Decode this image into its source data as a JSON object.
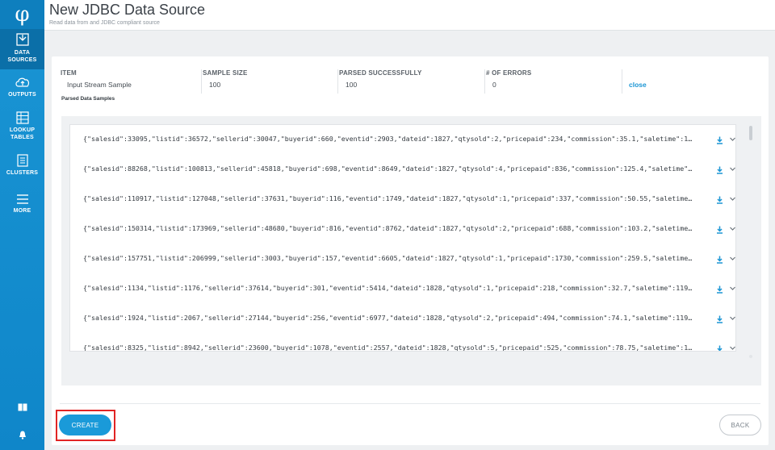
{
  "sidebar": {
    "logo": "φ",
    "items": [
      {
        "label_line1": "DATA",
        "label_line2": "SOURCES"
      },
      {
        "label_line1": "OUTPUTS",
        "label_line2": ""
      },
      {
        "label_line1": "LOOKUP",
        "label_line2": "TABLES"
      },
      {
        "label_line1": "CLUSTERS",
        "label_line2": ""
      },
      {
        "label_line1": "MORE",
        "label_line2": ""
      }
    ]
  },
  "header": {
    "title": "New JDBC Data Source",
    "subtitle": "Read data from and JDBC compliant source"
  },
  "summary": {
    "columns": [
      "ITEM",
      "SAMPLE SIZE",
      "PARSED SUCCESSFULLY",
      "# OF ERRORS"
    ],
    "values": [
      "Input Stream Sample",
      "100",
      "100",
      "0"
    ],
    "close_label": "close"
  },
  "samples": {
    "title": "Parsed Data Samples",
    "rows": [
      "{\"salesid\":33095,\"listid\":36572,\"sellerid\":30047,\"buyerid\":660,\"eventid\":2903,\"dateid\":1827,\"qtysold\":2,\"pricepaid\":234,\"commission\":35.1,\"saletime\":1…",
      "{\"salesid\":88268,\"listid\":100813,\"sellerid\":45818,\"buyerid\":698,\"eventid\":8649,\"dateid\":1827,\"qtysold\":4,\"pricepaid\":836,\"commission\":125.4,\"saletime\"…",
      "{\"salesid\":110917,\"listid\":127048,\"sellerid\":37631,\"buyerid\":116,\"eventid\":1749,\"dateid\":1827,\"qtysold\":1,\"pricepaid\":337,\"commission\":50.55,\"saletime…",
      "{\"salesid\":150314,\"listid\":173969,\"sellerid\":48680,\"buyerid\":816,\"eventid\":8762,\"dateid\":1827,\"qtysold\":2,\"pricepaid\":688,\"commission\":103.2,\"saletime…",
      "{\"salesid\":157751,\"listid\":206999,\"sellerid\":3003,\"buyerid\":157,\"eventid\":6605,\"dateid\":1827,\"qtysold\":1,\"pricepaid\":1730,\"commission\":259.5,\"saletime…",
      "{\"salesid\":1134,\"listid\":1176,\"sellerid\":37614,\"buyerid\":301,\"eventid\":5414,\"dateid\":1828,\"qtysold\":1,\"pricepaid\":218,\"commission\":32.7,\"saletime\":119…",
      "{\"salesid\":1924,\"listid\":2067,\"sellerid\":27144,\"buyerid\":256,\"eventid\":6977,\"dateid\":1828,\"qtysold\":2,\"pricepaid\":494,\"commission\":74.1,\"saletime\":119…",
      "{\"salesid\":8325,\"listid\":8942,\"sellerid\":23600,\"buyerid\":1078,\"eventid\":2557,\"dateid\":1828,\"qtysold\":5,\"pricepaid\":525,\"commission\":78.75,\"saletime\":1…"
    ]
  },
  "actions": {
    "create_label": "CREATE",
    "back_label": "BACK"
  },
  "colors": {
    "accent": "#1a95d4",
    "highlight": "#e12424"
  }
}
